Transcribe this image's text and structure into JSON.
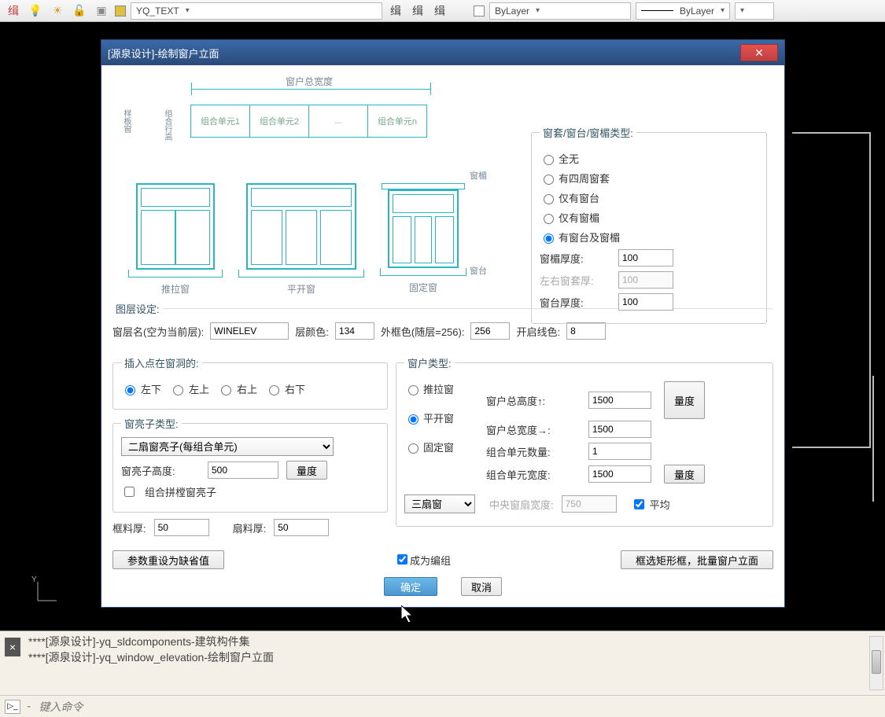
{
  "toolbar": {
    "layer_name": "YQ_TEXT",
    "bylayer1": "ByLayer",
    "bylayer2": "ByLayer"
  },
  "dialog": {
    "title": "[源泉设计]-绘制窗户立面"
  },
  "diagram": {
    "width_label": "窗户总宽度",
    "height_label": "组合行高",
    "unit1": "组合单元1",
    "unit2": "组合单元2",
    "unit_dots": "...",
    "unitn": "组合单元n",
    "win1": "推拉窗",
    "win2": "平开窗",
    "win3": "固定窗",
    "lintel": "窗楣",
    "sill": "窗台",
    "side_label": "样板窗"
  },
  "frame_type": {
    "legend": "窗套/窗台/窗楣类型:",
    "opt_none": "全无",
    "opt_surround": "有四周窗套",
    "opt_sill": "仅有窗台",
    "opt_lintel": "仅有窗楣",
    "opt_both": "有窗台及窗楣",
    "lintel_thick_label": "窗楣厚度:",
    "lintel_thick": "100",
    "side_thick_label": "左右窗套厚:",
    "side_thick": "100",
    "sill_thick_label": "窗台厚度:",
    "sill_thick": "100"
  },
  "layer": {
    "legend": "图层设定:",
    "name_label": "窗层名(空为当前层):",
    "name": "WINELEV",
    "color_label": "层颜色:",
    "color": "134",
    "outer_label": "外框色(随层=256):",
    "outer": "256",
    "open_label": "开启线色:",
    "open": "8"
  },
  "insert": {
    "legend": "插入点在窗洞的:",
    "bl": "左下",
    "tl": "左上",
    "tr": "右上",
    "br": "右下"
  },
  "transom": {
    "legend": "窗亮子类型:",
    "combo": "二扇窗亮子(每组合单元)",
    "height_label": "窗亮子高度:",
    "height": "500",
    "measure": "量度",
    "combine_chk": "组合拼樘窗亮子",
    "frame_thick_label": "框料厚:",
    "frame_thick": "50",
    "sash_thick_label": "扇料厚:",
    "sash_thick": "50"
  },
  "wintype": {
    "legend": "窗户类型:",
    "sliding": "推拉窗",
    "casement": "平开窗",
    "fixed": "固定窗",
    "total_h_label": "窗户总高度↑:",
    "total_h": "1500",
    "total_w_label": "窗户总宽度→:",
    "total_w": "1500",
    "unit_count_label": "组合单元数量:",
    "unit_count": "1",
    "unit_w_label": "组合单元宽度:",
    "unit_w": "1500",
    "measure": "量度",
    "sash_combo": "三扇窗",
    "center_w_label": "中央窗扇宽度:",
    "center_w": "750",
    "avg_chk": "平均"
  },
  "footer": {
    "reset": "参数重设为缺省值",
    "group_chk": "成为编组",
    "batch": "框选矩形框，批量窗户立面",
    "ok": "确定",
    "cancel": "取消"
  },
  "cmd": {
    "line1": "****[源泉设计]-yq_sldcomponents-建筑构件集",
    "line2": "****[源泉设计]-yq_window_elevation-绘制窗户立面",
    "placeholder": "键入命令"
  }
}
